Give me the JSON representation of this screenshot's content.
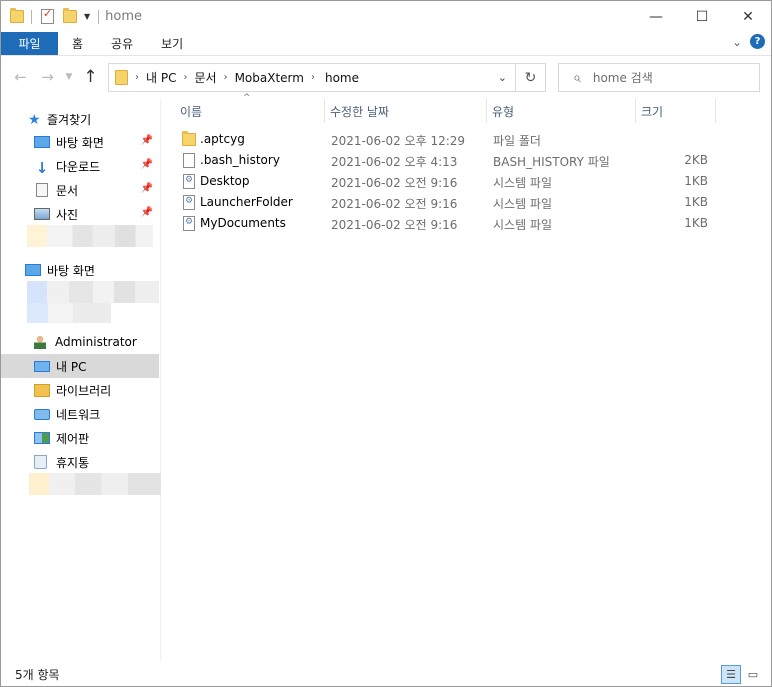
{
  "window": {
    "title": "home",
    "controls": {
      "minimize": "—",
      "maximize": "☐",
      "close": "✕"
    }
  },
  "ribbon": {
    "tabs": [
      {
        "label": "파일",
        "active": true
      },
      {
        "label": "홈"
      },
      {
        "label": "공유"
      },
      {
        "label": "보기"
      }
    ]
  },
  "address": {
    "crumbs": [
      "내 PC",
      "문서",
      "MobaXterm",
      "home"
    ]
  },
  "search": {
    "placeholder": "home 검색"
  },
  "sidebar": {
    "quick_access": "즐겨찾기",
    "pinned": [
      "바탕 화면",
      "다운로드",
      "문서",
      "사진"
    ],
    "desktop": "바탕 화면",
    "items": [
      "Administrator",
      "내 PC",
      "라이브러리",
      "네트워크",
      "제어판",
      "휴지통"
    ],
    "selected": "내 PC"
  },
  "columns": [
    "이름",
    "수정한 날짜",
    "유형",
    "크기"
  ],
  "files": [
    {
      "name": ".aptcyg",
      "date": "2021-06-02 오후 12:29",
      "type": "파일 폴더",
      "size": "",
      "icon": "folder-icon"
    },
    {
      "name": ".bash_history",
      "date": "2021-06-02 오후 4:13",
      "type": "BASH_HISTORY 파일",
      "size": "2KB",
      "icon": "file-icon"
    },
    {
      "name": "Desktop",
      "date": "2021-06-02 오전 9:16",
      "type": "시스템 파일",
      "size": "1KB",
      "icon": "system-file-icon"
    },
    {
      "name": "LauncherFolder",
      "date": "2021-06-02 오전 9:16",
      "type": "시스템 파일",
      "size": "1KB",
      "icon": "system-file-icon"
    },
    {
      "name": "MyDocuments",
      "date": "2021-06-02 오전 9:16",
      "type": "시스템 파일",
      "size": "1KB",
      "icon": "system-file-icon"
    }
  ],
  "status": {
    "item_count": "5개 항목"
  },
  "colors": {
    "ribbon_file_tab": "#1e6bb8",
    "selection": "#d9d9d9",
    "column_header_text": "#4c607a"
  }
}
